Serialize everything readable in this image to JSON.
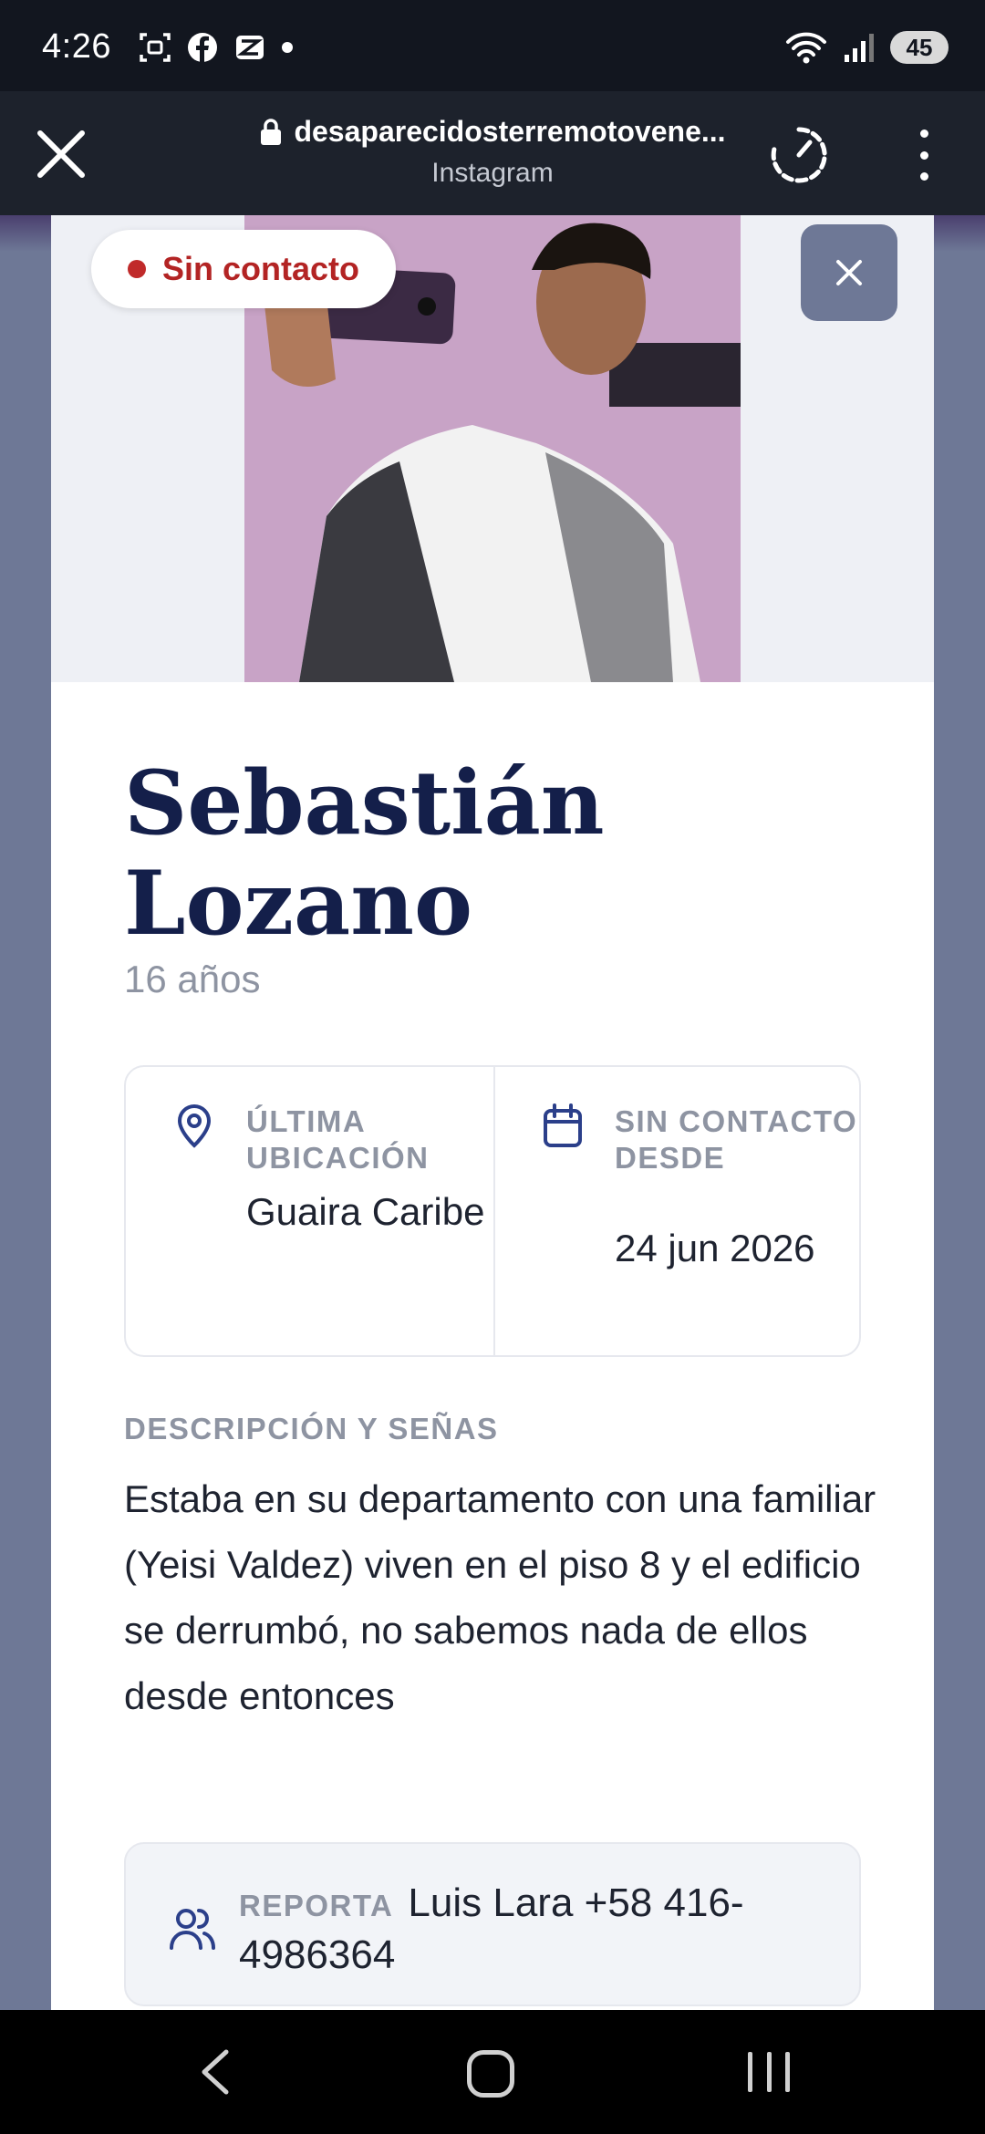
{
  "status_bar": {
    "time": "4:26",
    "battery": "45"
  },
  "browser": {
    "url": "desaparecidosterremotovene...",
    "subtitle": "Instagram"
  },
  "card": {
    "status_badge": "Sin contacto",
    "name": "Sebastián Lozano",
    "age": "16 años",
    "last_location": {
      "label": "ÚLTIMA UBICACIÓN",
      "value": "Guaira Caribe"
    },
    "no_contact_since": {
      "label": "SIN CONTACTO DESDE",
      "value": "24 jun 2026"
    },
    "description_label": "DESCRIPCIÓN Y SEÑAS",
    "description": "Estaba en su departamento con una familiar (Yeisi Valdez) viven en el piso 8 y el edificio se derrumbó, no sabemos nada de ellos desde entonces",
    "reporter_label": "REPORTA",
    "reporter": "Luis Lara +58 416-4986364"
  },
  "colors": {
    "name_navy": "#141f4a",
    "badge_red": "#b32424",
    "accent_icon": "#2b3f8a",
    "backdrop": "#6e7896"
  },
  "icons": [
    "screenshot-icon",
    "facebook-icon",
    "app-icon",
    "wifi-icon",
    "signal-icon",
    "lock-icon",
    "close-icon",
    "speed-icon",
    "menu-icon",
    "location-pin-icon",
    "calendar-icon",
    "people-icon",
    "back-icon",
    "home-icon",
    "recents-icon"
  ]
}
